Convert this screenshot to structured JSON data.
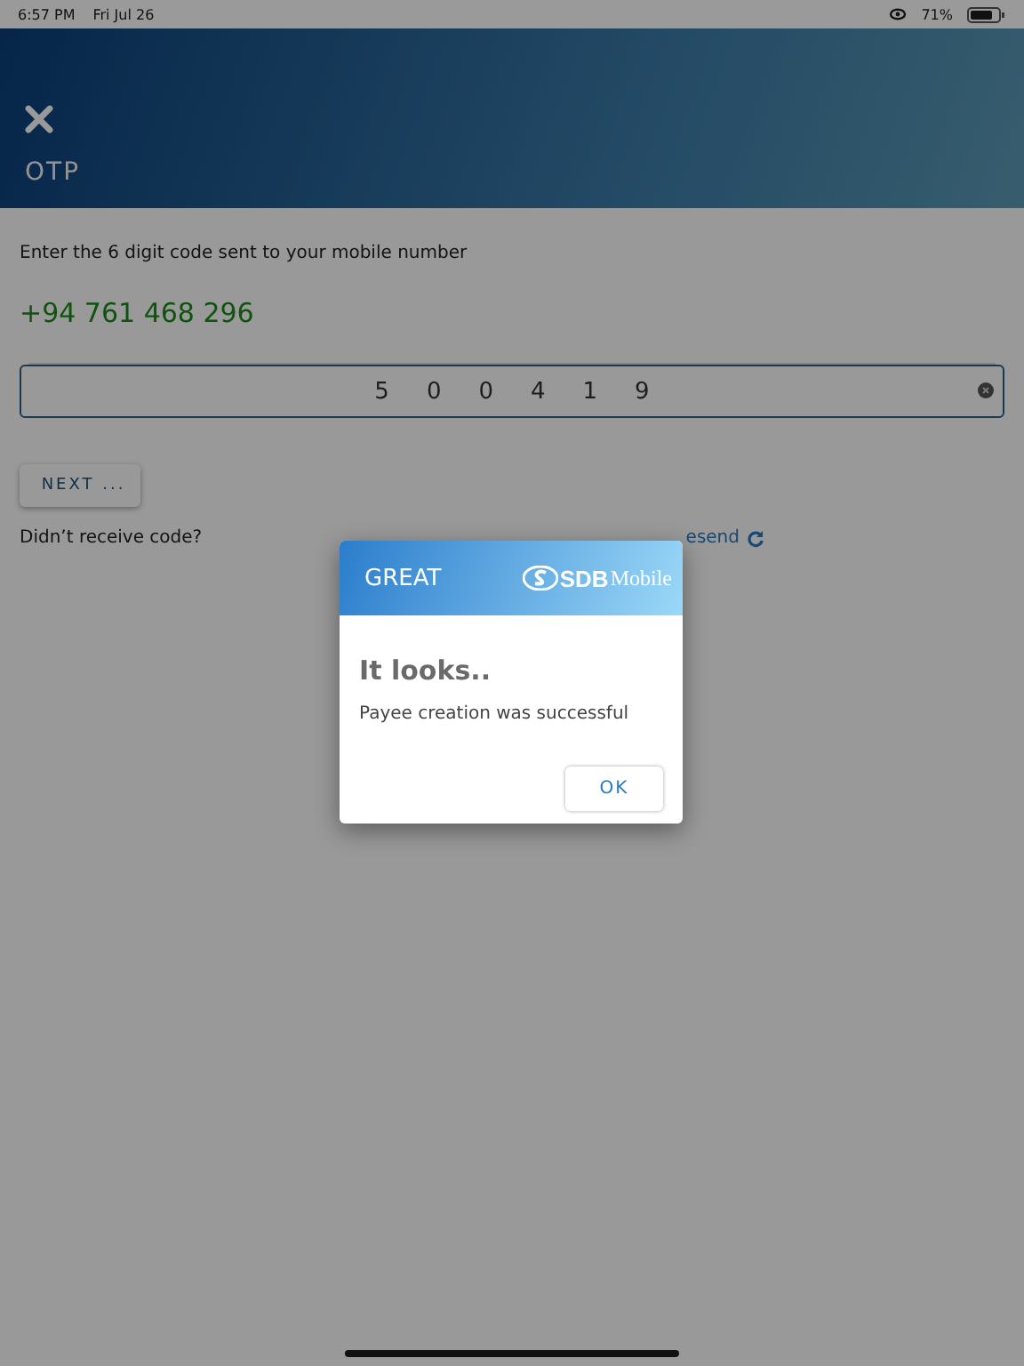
{
  "status_bar": {
    "time": "6:57 PM",
    "date": "Fri Jul 26",
    "battery": "71%"
  },
  "header": {
    "title": "OTP"
  },
  "instruction": "Enter the 6 digit code sent to your mobile number",
  "phone": "+94 761 468 296",
  "otp_field": {
    "value": "500419"
  },
  "next_button": "NEXT ...",
  "resend_prompt": "Didn’t receive code?",
  "resend_link": "esend",
  "dialog": {
    "header": "GREAT",
    "logo": "SDB",
    "logo_suffix": "Mobile",
    "title": "It looks..",
    "message": "Payee creation was successful",
    "button": "OK"
  }
}
